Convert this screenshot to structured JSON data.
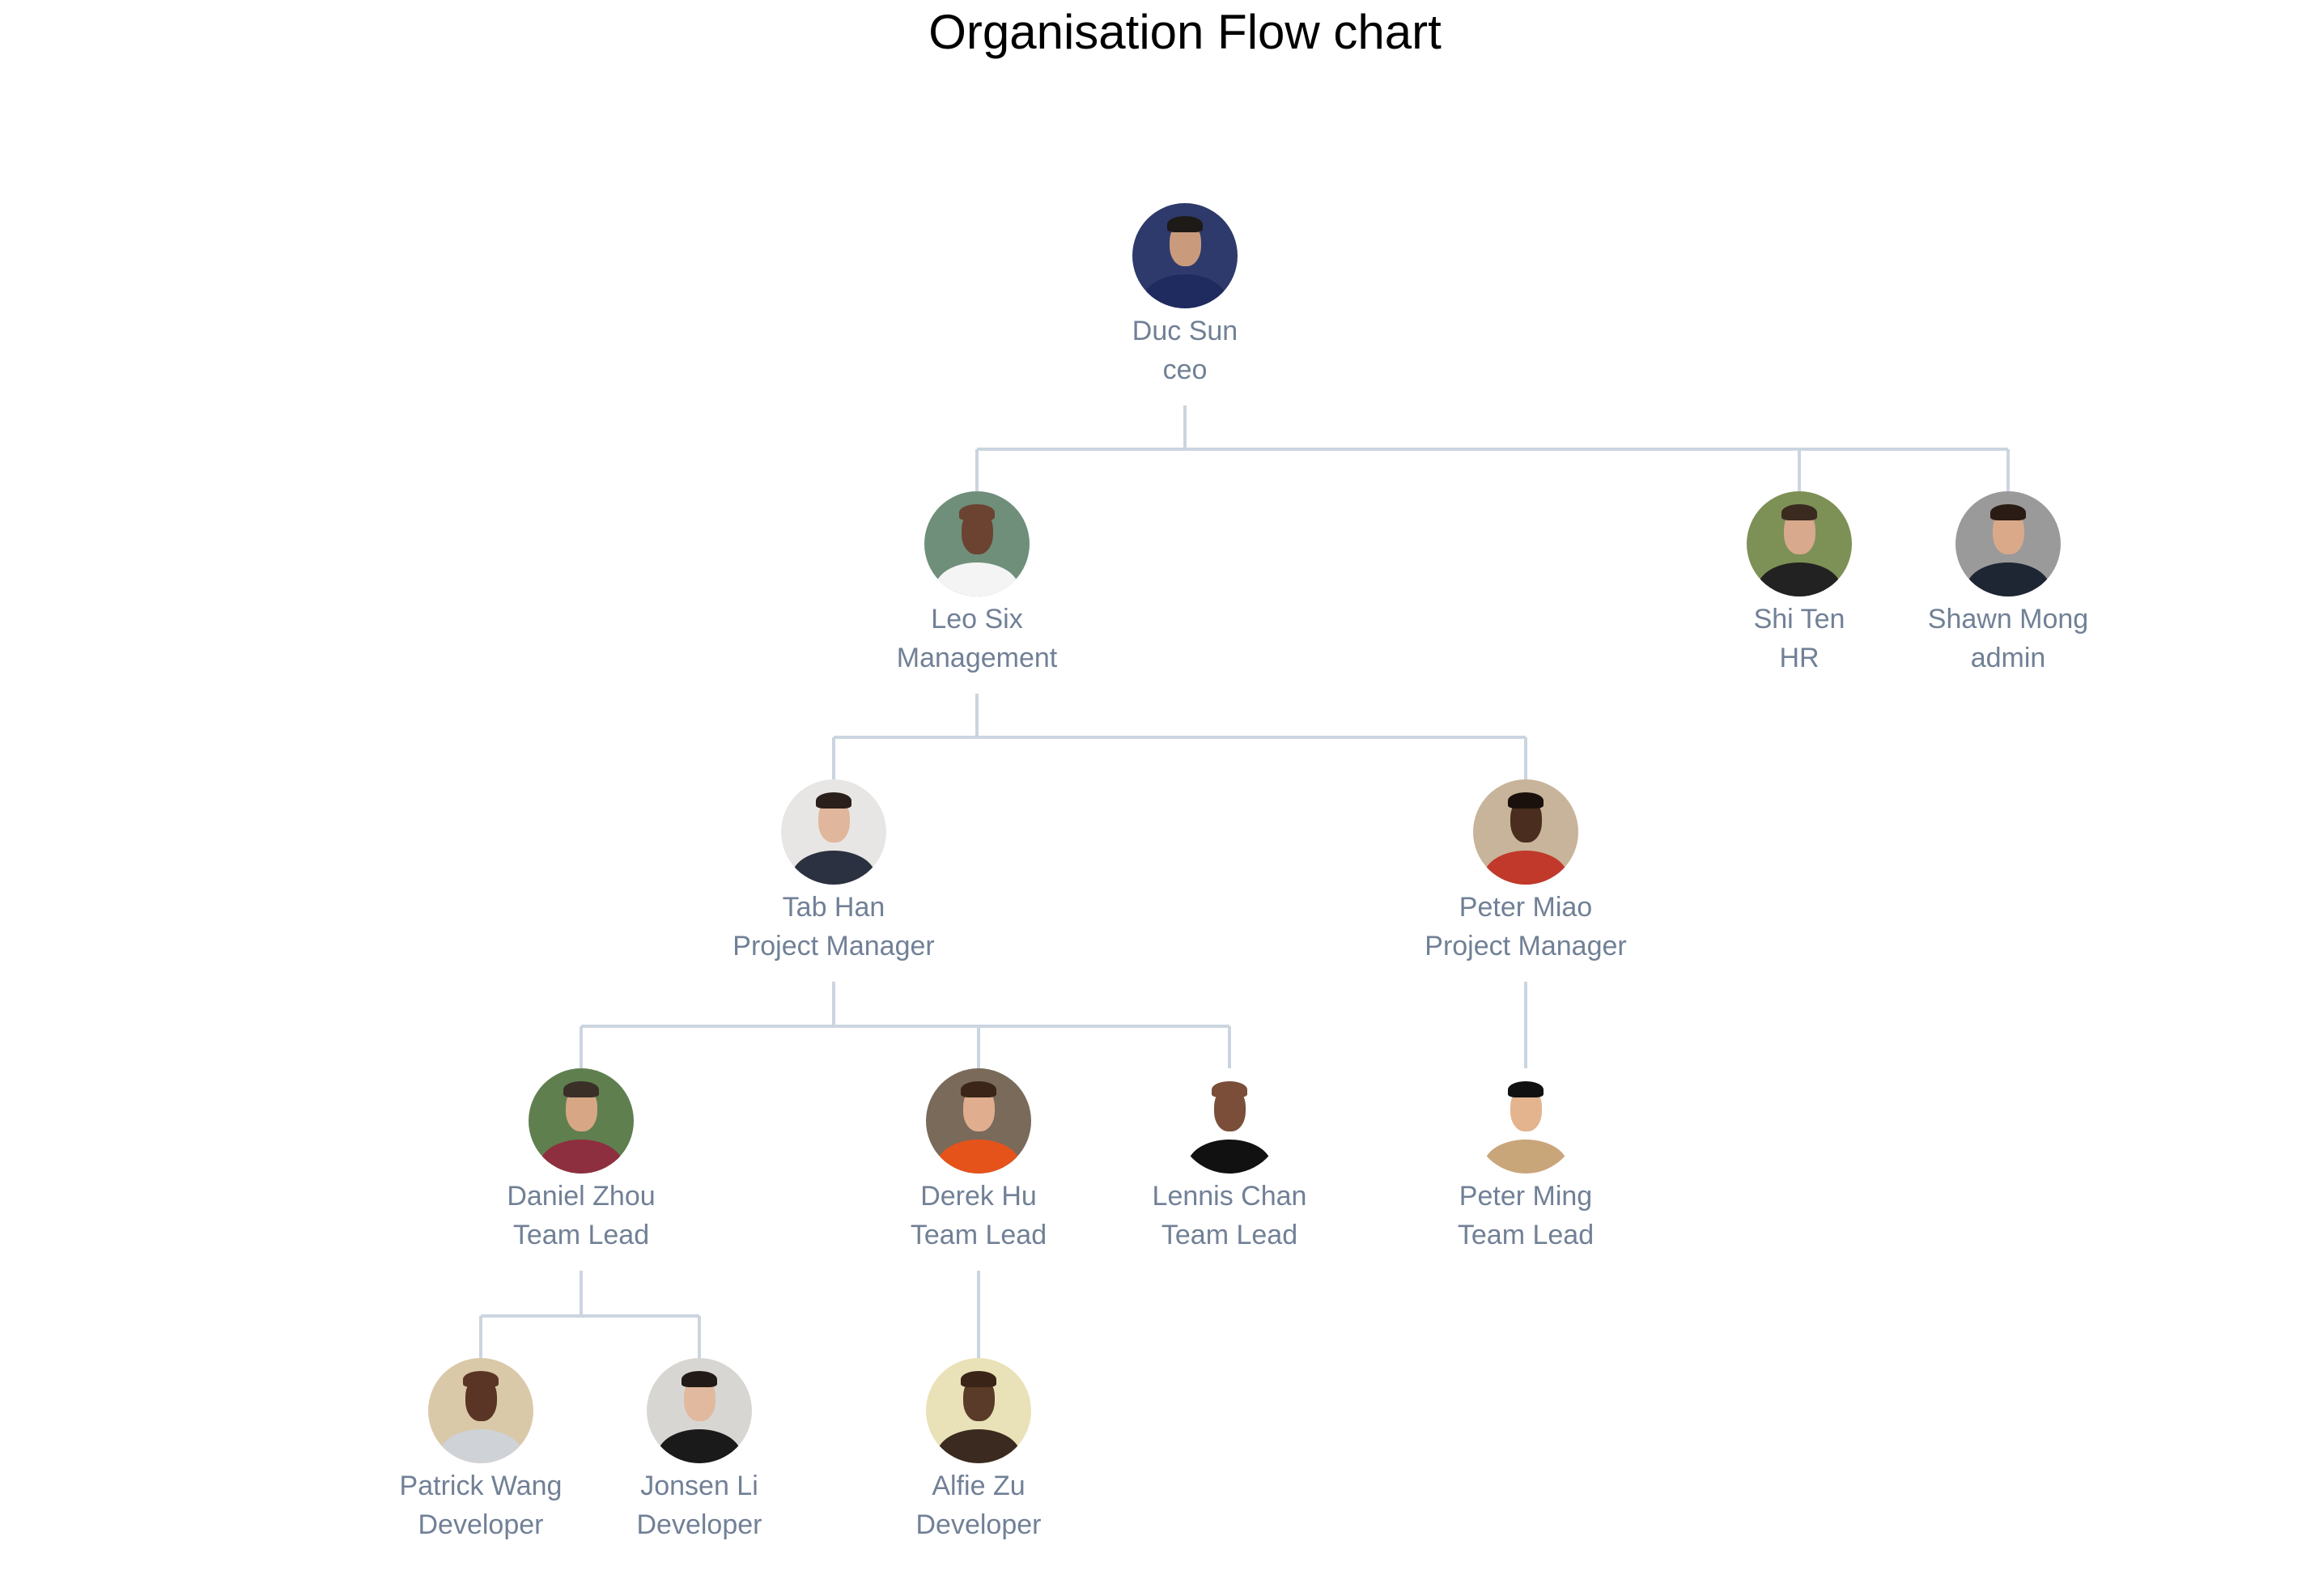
{
  "title": "Organisation Flow chart",
  "colors": {
    "connector": "#cbd5e0",
    "text": "#718096",
    "title": "#000000"
  },
  "nodes": [
    {
      "id": "duc",
      "name": "Duc Sun",
      "role": "ceo",
      "parent": null,
      "bg": "#2d3a6b",
      "skin": "#c99a7c",
      "hair": "#1e1a18",
      "shirt": "#1f2a5e"
    },
    {
      "id": "leo",
      "name": "Leo Six",
      "role": "Management",
      "parent": "duc",
      "bg": "#6f8f7a",
      "skin": "#6b4330",
      "hair": "#6b4330",
      "shirt": "#f4f4f4"
    },
    {
      "id": "shi",
      "name": "Shi Ten",
      "role": "HR",
      "parent": "duc",
      "bg": "#7d9157",
      "skin": "#d8a98c",
      "hair": "#3a2a20",
      "shirt": "#222222"
    },
    {
      "id": "shawn",
      "name": "Shawn Mong",
      "role": "admin",
      "parent": "duc",
      "bg": "#9a9a9a",
      "skin": "#d9a98a",
      "hair": "#2a1c14",
      "shirt": "#1f2633"
    },
    {
      "id": "tab",
      "name": "Tab Han",
      "role": "Project Manager",
      "parent": "leo",
      "bg": "#e8e6e4",
      "skin": "#e0b79c",
      "hair": "#2a1f1a",
      "shirt": "#2b3140"
    },
    {
      "id": "miao",
      "name": "Peter Miao",
      "role": "Project Manager",
      "parent": "leo",
      "bg": "#c8b49a",
      "skin": "#4a2d1f",
      "hair": "#1a110c",
      "shirt": "#c0392b"
    },
    {
      "id": "daniel",
      "name": "Daniel Zhou",
      "role": "Team Lead",
      "parent": "tab",
      "bg": "#5f7f4f",
      "skin": "#d7a785",
      "hair": "#3a3028",
      "shirt": "#8e2f3f"
    },
    {
      "id": "derek",
      "name": "Derek Hu",
      "role": "Team Lead",
      "parent": "tab",
      "bg": "#7a6a5a",
      "skin": "#e0ad8e",
      "hair": "#3a2518",
      "shirt": "#e5531a"
    },
    {
      "id": "lennis",
      "name": "Lennis Chan",
      "role": "Team Lead",
      "parent": "tab",
      "bg": "#ffffff",
      "skin": "#7a4e38",
      "hair": "#7a4e38",
      "shirt": "#111111"
    },
    {
      "id": "ming",
      "name": "Peter Ming",
      "role": "Team Lead",
      "parent": "miao",
      "bg": "#ffffff",
      "skin": "#e3b48e",
      "hair": "#111111",
      "shirt": "#c9a57a"
    },
    {
      "id": "patrick",
      "name": "Patrick Wang",
      "role": "Developer",
      "parent": "daniel",
      "bg": "#d9c9a9",
      "skin": "#5a3424",
      "hair": "#5a3424",
      "shirt": "#cfd2d6"
    },
    {
      "id": "jonsen",
      "name": "Jonsen Li",
      "role": "Developer",
      "parent": "daniel",
      "bg": "#d8d6d2",
      "skin": "#e1b99e",
      "hair": "#221a16",
      "shirt": "#1a1a1a"
    },
    {
      "id": "alfie",
      "name": "Alfie Zu",
      "role": "Developer",
      "parent": "derek",
      "bg": "#e9e2b8",
      "skin": "#5a3a28",
      "hair": "#3a2418",
      "shirt": "#3a2a20"
    }
  ]
}
